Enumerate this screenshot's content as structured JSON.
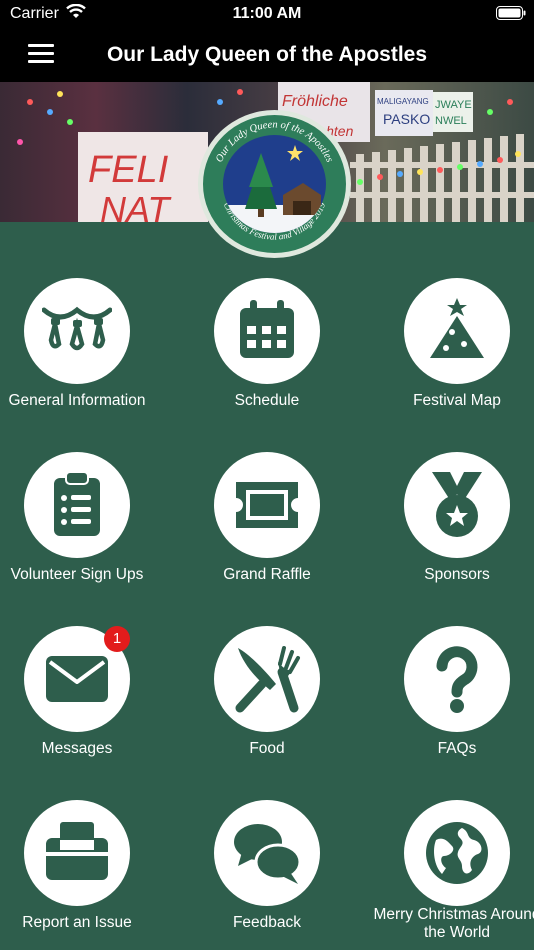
{
  "status_bar": {
    "carrier": "Carrier",
    "time": "11:00 AM"
  },
  "header": {
    "title": "Our Lady Queen of the Apostles"
  },
  "logo": {
    "top_text": "Our Lady Queen of the Apostles",
    "bottom_text": "Christmas Festival and Village 2019"
  },
  "banner": {
    "signs": [
      "FELI",
      "NAT",
      "Fröhliche",
      "ichten",
      "MALIGAYANG",
      "PASKO",
      "JWAYE",
      "NWEL"
    ]
  },
  "colors": {
    "background": "#2e5e4c",
    "accent": "#2e5e4c",
    "badge": "#e21c1c"
  },
  "menu": [
    {
      "label": "General Information",
      "icon": "string-lights-icon"
    },
    {
      "label": "Schedule",
      "icon": "calendar-icon"
    },
    {
      "label": "Festival Map",
      "icon": "christmas-tree-icon"
    },
    {
      "label": "Volunteer Sign Ups",
      "icon": "clipboard-icon"
    },
    {
      "label": "Grand Raffle",
      "icon": "ticket-icon"
    },
    {
      "label": "Sponsors",
      "icon": "medal-icon"
    },
    {
      "label": "Messages",
      "icon": "envelope-icon",
      "badge": "1"
    },
    {
      "label": "Food",
      "icon": "utensils-icon"
    },
    {
      "label": "FAQs",
      "icon": "question-icon"
    },
    {
      "label": "Report an Issue",
      "icon": "printer-icon"
    },
    {
      "label": "Feedback",
      "icon": "chat-bubbles-icon"
    },
    {
      "label": "Merry Christmas Around the World",
      "icon": "globe-icon"
    }
  ]
}
